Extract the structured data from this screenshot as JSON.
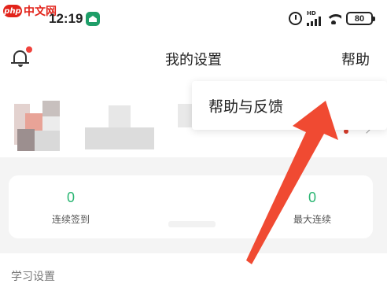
{
  "watermark": {
    "logo": "php",
    "text": "中文网"
  },
  "status_bar": {
    "time": "12:19",
    "network_label": "HD",
    "battery": "80"
  },
  "header": {
    "title": "我的设置",
    "help_label": "帮助"
  },
  "dropdown": {
    "items": [
      {
        "label": "帮助与反馈"
      }
    ]
  },
  "stats": [
    {
      "value": "0",
      "label": "连续签到"
    },
    {
      "value": "0",
      "label": "最大连续"
    }
  ],
  "section": {
    "title": "学习设置"
  },
  "colors": {
    "accent_green": "#2bb673",
    "badge_red": "#f0423c",
    "arrow_red": "#f04a32"
  }
}
